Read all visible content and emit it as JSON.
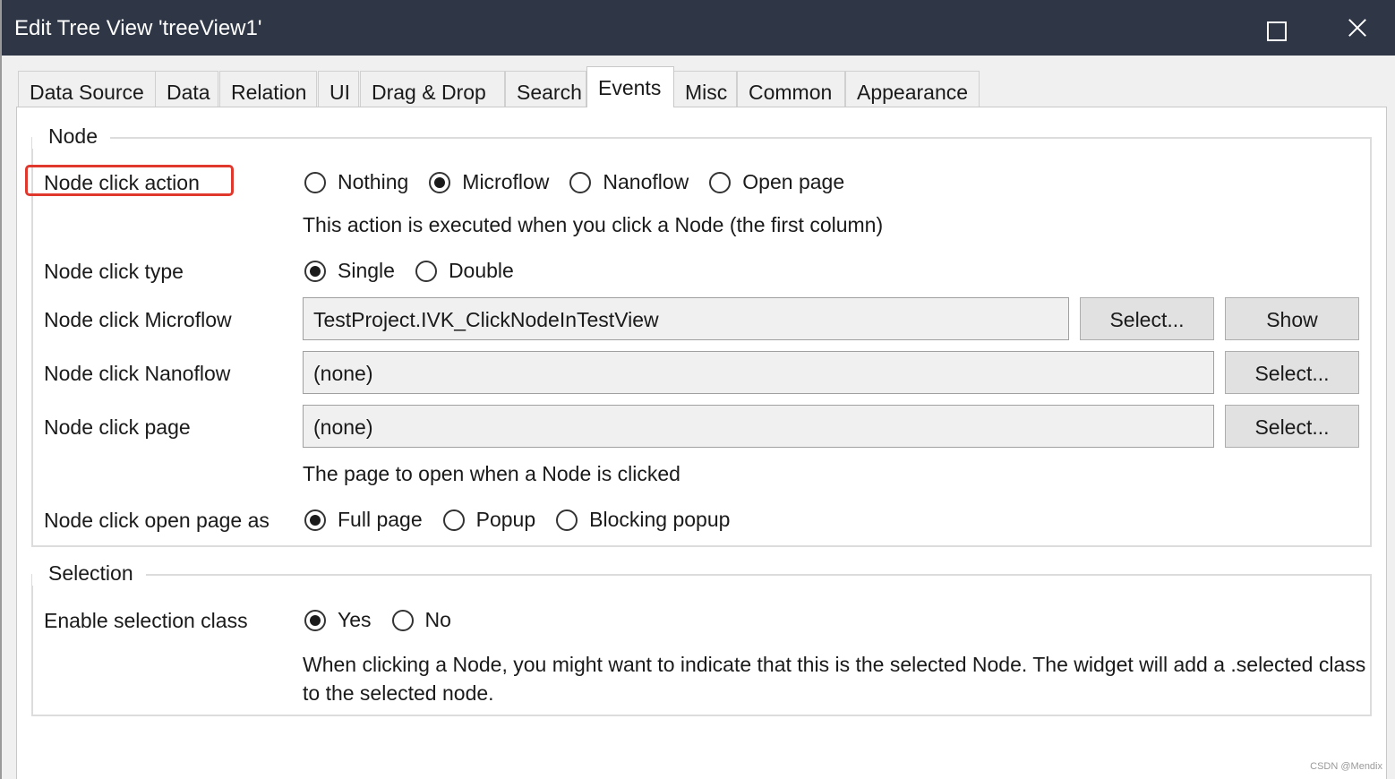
{
  "window": {
    "title": "Edit Tree View 'treeView1'"
  },
  "tabs": [
    {
      "label": "Data Source"
    },
    {
      "label": "Data"
    },
    {
      "label": "Relation"
    },
    {
      "label": "UI"
    },
    {
      "label": "Drag & Drop"
    },
    {
      "label": "Search"
    },
    {
      "label": "Events",
      "active": true
    },
    {
      "label": "Misc"
    },
    {
      "label": "Common"
    },
    {
      "label": "Appearance"
    }
  ],
  "node_group": {
    "title": "Node",
    "click_action": {
      "label": "Node click action",
      "options": [
        "Nothing",
        "Microflow",
        "Nanoflow",
        "Open page"
      ],
      "selected": "Microflow",
      "help": "This action is executed when you click a Node (the first column)"
    },
    "click_type": {
      "label": "Node click type",
      "options": [
        "Single",
        "Double"
      ],
      "selected": "Single"
    },
    "click_microflow": {
      "label": "Node click Microflow",
      "value": "TestProject.IVK_ClickNodeInTestView",
      "select_label": "Select...",
      "show_label": "Show"
    },
    "click_nanoflow": {
      "label": "Node click Nanoflow",
      "value": "(none)",
      "select_label": "Select..."
    },
    "click_page": {
      "label": "Node click page",
      "value": "(none)",
      "select_label": "Select...",
      "help": "The page to open when a Node is clicked"
    },
    "open_page_as": {
      "label": "Node click open page as",
      "options": [
        "Full page",
        "Popup",
        "Blocking popup"
      ],
      "selected": "Full page"
    }
  },
  "selection_group": {
    "title": "Selection",
    "enable_class": {
      "label": "Enable selection class",
      "options": [
        "Yes",
        "No"
      ],
      "selected": "Yes",
      "help": "When clicking a Node, you might want to indicate that this is the selected Node. The widget will add a .selected class to the selected node."
    }
  },
  "watermark": "CSDN @Mendix",
  "colors": {
    "titlebar": "#2f3747",
    "highlight": "#e0382c"
  }
}
